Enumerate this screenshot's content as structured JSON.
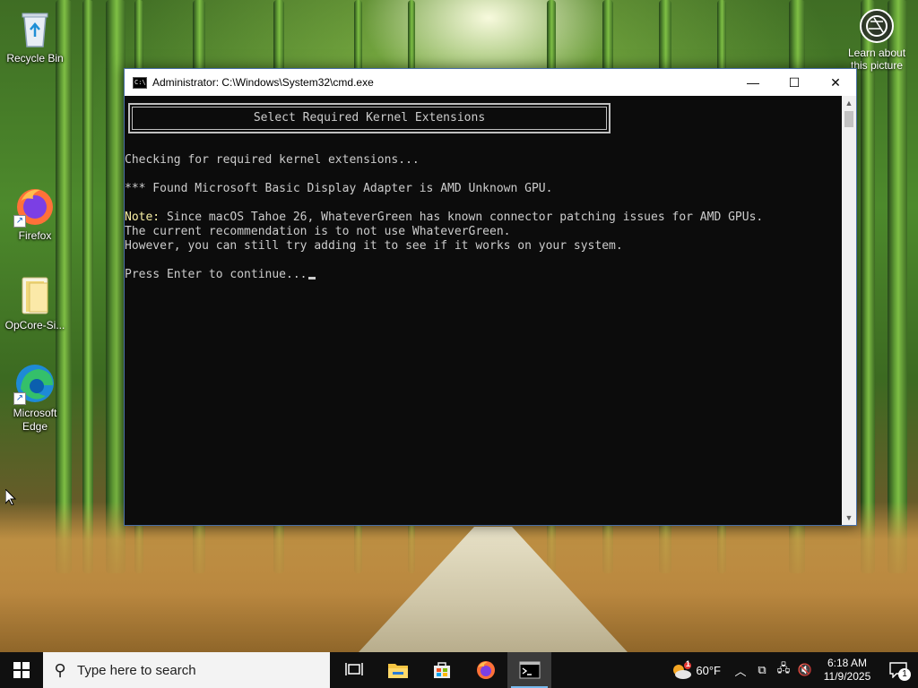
{
  "desktop": {
    "icons": [
      {
        "label": "Recycle Bin",
        "icon": "recycle-bin-icon"
      },
      {
        "label": "Firefox",
        "icon": "firefox-icon"
      },
      {
        "label": "OpCore-Si...",
        "icon": "folder-icon"
      },
      {
        "label": "Microsoft Edge",
        "icon": "edge-icon"
      }
    ],
    "learn_line1": "Learn about",
    "learn_line2": "this picture"
  },
  "window": {
    "title": "Administrator: C:\\Windows\\System32\\cmd.exe",
    "app_icon_text": "C:\\",
    "minimize": "—",
    "maximize": "☐",
    "close": "✕"
  },
  "console": {
    "banner": "Select Required Kernel Extensions",
    "lines": [
      "Checking for required kernel extensions...",
      "*** Found Microsoft Basic Display Adapter is AMD Unknown GPU.",
      "Note: Since macOS Tahoe 26, WhateverGreen has known connector patching issues for AMD GPUs.",
      "The current recommendation is to not use WhateverGreen.",
      "However, you can still try adding it to see if it works on your system.",
      "Press Enter to continue..."
    ],
    "note_prefix": "Note:",
    "note_rest": " Since macOS Tahoe 26, WhateverGreen has known connector patching issues for AMD GPUs."
  },
  "taskbar": {
    "search_placeholder": "Type here to search",
    "weather_temp": "60°F",
    "weather_badge": "1",
    "time": "6:18 AM",
    "date": "11/9/2025",
    "notification_count": "1"
  },
  "colors": {
    "console_bg": "#0c0c0c",
    "console_text": "#cccccc",
    "taskbar_bg": "#101010",
    "active_indicator": "#76b9ed"
  }
}
